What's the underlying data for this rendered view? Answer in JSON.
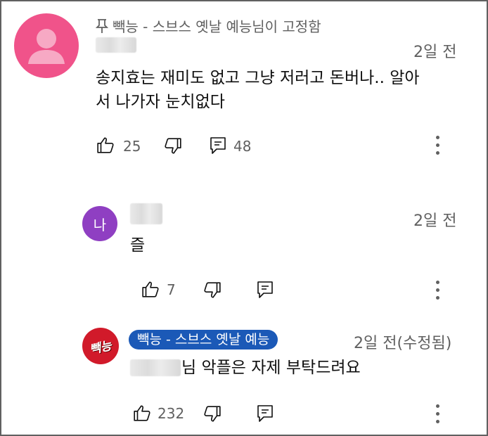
{
  "colors": {
    "primary_avatar": "#f0538a",
    "reply_avatar": "#8f3fc2",
    "owner_avatar": "#d11a2a",
    "badge_bg": "#1b59b7",
    "muted_text": "#606060"
  },
  "pinned": {
    "icon": "pin-icon",
    "label": "빽능 - 스브스 옛날 예능님이 고정함"
  },
  "comment": {
    "time": "2일 전",
    "text_line1": "송지효는 재미도 없고 그냥 저러고 돈버나.. 알아",
    "text_line2": "서 나가자 눈치없다",
    "likes": "25",
    "replies": "48"
  },
  "replies": [
    {
      "avatar_letter": "나",
      "time": "2일 전",
      "text": "즐",
      "likes": "7"
    },
    {
      "avatar_logo": "빽능",
      "author_badge": "빽능 - 스브스 옛날 예능",
      "time": "2일 전(수정됨)",
      "text": "님 악플은 자제 부탁드려요",
      "likes": "232"
    }
  ]
}
